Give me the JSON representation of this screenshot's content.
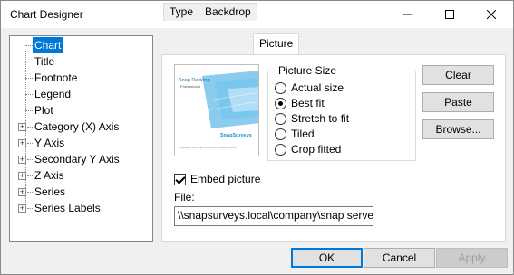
{
  "window": {
    "title": "Chart Designer"
  },
  "tree": {
    "items": [
      {
        "label": "Chart",
        "selected": true,
        "expandable": false
      },
      {
        "label": "Title",
        "expandable": false
      },
      {
        "label": "Footnote",
        "expandable": false
      },
      {
        "label": "Legend",
        "expandable": false
      },
      {
        "label": "Plot",
        "expandable": false
      },
      {
        "label": "Category (X) Axis",
        "expandable": true
      },
      {
        "label": "Y Axis",
        "expandable": true
      },
      {
        "label": "Secondary Y Axis",
        "expandable": true
      },
      {
        "label": "Z Axis",
        "expandable": true
      },
      {
        "label": "Series",
        "expandable": true
      },
      {
        "label": "Series Labels",
        "expandable": true
      }
    ]
  },
  "tabs": [
    {
      "label": "Type"
    },
    {
      "label": "Backdrop"
    },
    {
      "label": "Picture",
      "active": true
    }
  ],
  "picture_size": {
    "legend": "Picture Size",
    "options": [
      {
        "label": "Actual size",
        "checked": false
      },
      {
        "label": "Best fit",
        "checked": true
      },
      {
        "label": "Stretch to fit",
        "checked": false
      },
      {
        "label": "Tiled",
        "checked": false
      },
      {
        "label": "Crop fitted",
        "checked": false
      }
    ]
  },
  "preview": {
    "heading": "Snap Desktop",
    "subheading": "Professional",
    "brand": "SnapSurveys",
    "copyright": "Copyright © 2019 Snap Surveys Ltd. All rights reserved."
  },
  "buttons": {
    "clear": "Clear",
    "paste": "Paste",
    "browse": "Browse...",
    "ok": "OK",
    "cancel": "Cancel",
    "apply": "Apply"
  },
  "embed": {
    "label": "Embed picture",
    "checked": true
  },
  "file": {
    "label": "File:",
    "value": "\\\\snapsurveys.local\\company\\snap server\\S"
  },
  "colors": {
    "accent": "#0078d7",
    "brand": "#1e8fd0"
  }
}
